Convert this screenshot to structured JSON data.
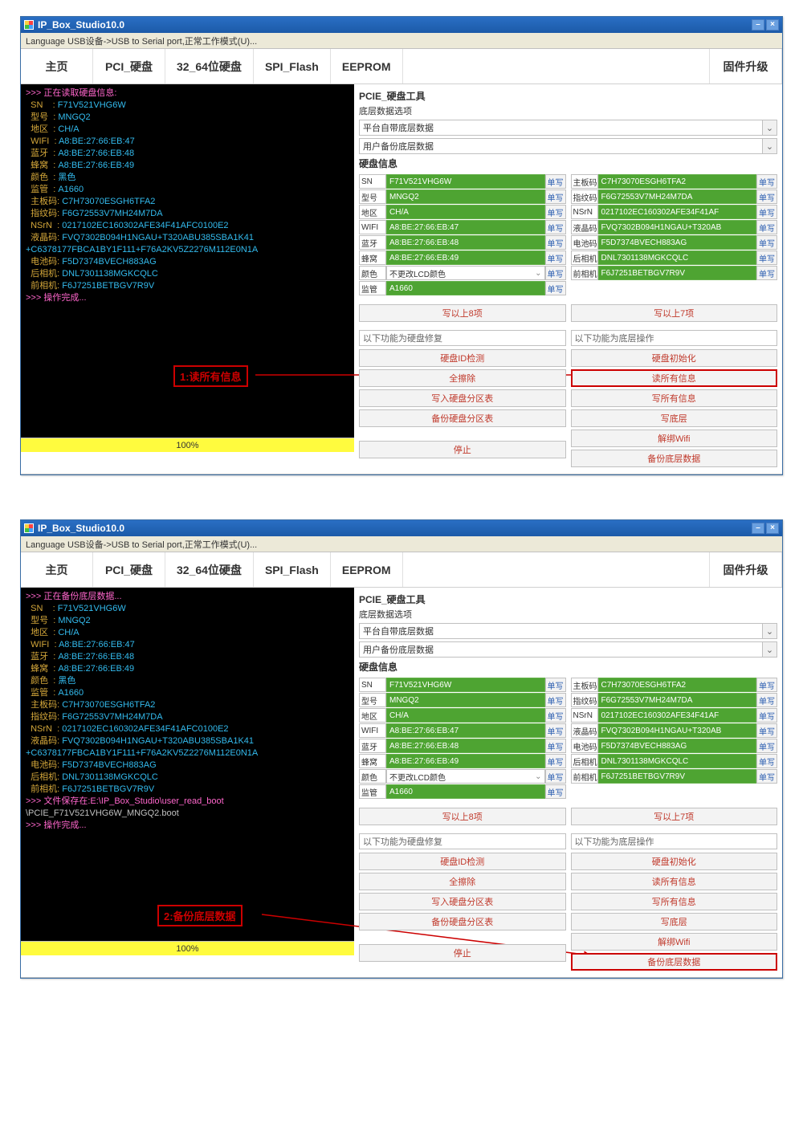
{
  "app": {
    "title": "IP_Box_Studio10.0",
    "menu": "Language  USB设备->USB to Serial port,正常工作模式(U)..."
  },
  "tabs": {
    "home": "主页",
    "pci": "PCI_硬盘",
    "bits": "32_64位硬盘",
    "spi": "SPI_Flash",
    "eeprom": "EEPROM",
    "fw": "固件升级"
  },
  "rpanel": {
    "title": "PCIE_硬盘工具",
    "option_label": "底层数据选项",
    "drop1": "平台自带底层数据",
    "drop2": "用户备份底层数据",
    "info_title": "硬盘信息",
    "left_labels": [
      "SN",
      "型号",
      "地区",
      "WIFI",
      "蓝牙",
      "蜂窝",
      "颜色",
      "监管"
    ],
    "right_labels": [
      "主板码",
      "指纹码",
      "NSrN",
      "液晶码",
      "电池码",
      "后相机",
      "前相机"
    ],
    "left_vals": [
      "F71V521VHG6W",
      "MNGQ2",
      "CH/A",
      "A8:BE:27:66:EB:47",
      "A8:BE:27:66:EB:48",
      "A8:BE:27:66:EB:49",
      "不更改LCD颜色",
      "A1660"
    ],
    "right_vals": [
      "C7H73070ESGH6TFA2",
      "F6G72553V7MH24M7DA",
      "0217102EC160302AFE34F41AF",
      "FVQ7302B094H1NGAU+T320AB",
      "F5D7374BVECH883AG",
      "DNL7301138MGKCQLC",
      "F6J7251BETBGV7R9V"
    ],
    "single_write": "单写",
    "write8": "写以上8项",
    "write7": "写以上7项",
    "left_head": "以下功能为硬盘修复",
    "right_head": "以下功能为底层操作",
    "left_btns": [
      "硬盘ID检测",
      "全擦除",
      "写入硬盘分区表",
      "备份硬盘分区表",
      "停止"
    ],
    "right_btns": [
      "硬盘初始化",
      "读所有信息",
      "写所有信息",
      "写底层",
      "解绑Wifi",
      "备份底层数据"
    ]
  },
  "progress": "100%",
  "term1": {
    "head": ">>> 正在读取硬盘信息:",
    "lines": [
      "  SN    : F71V521VHG6W",
      "  型号  : MNGQ2",
      "  地区  : CH/A",
      "  WIFI  : A8:BE:27:66:EB:47",
      "  蓝牙  : A8:BE:27:66:EB:48",
      "  蜂窝  : A8:BE:27:66:EB:49",
      "  颜色  : 黑色",
      "  监管  : A1660",
      "  主板码: C7H73070ESGH6TFA2",
      "  指纹码: F6G72553V7MH24M7DA",
      "  NSrN  : 0217102EC160302AFE34F41AFC0100E2",
      "  液晶码: FVQ7302B094H1NGAU+T320ABU385SBA1K41",
      "+C6378177FBCA1BY1F111+F76A2KV5Z2276M112E0N1A",
      "  电池码: F5D7374BVECH883AG",
      "  后相机: DNL7301138MGKCQLC",
      "  前相机: F6J7251BETBGV7R9V"
    ],
    "done": ">>> 操作完成..."
  },
  "term2": {
    "head": ">>> 正在备份底层数据...",
    "lines_same": true,
    "saved1": ">>> 文件保存在:E:\\IP_Box_Studio\\user_read_boot",
    "saved2": "\\PCIE_F71V521VHG6W_MNGQ2.boot",
    "done": ">>> 操作完成..."
  },
  "annots": {
    "a1": "1:读所有信息",
    "a2": "2:备份底层数据"
  }
}
